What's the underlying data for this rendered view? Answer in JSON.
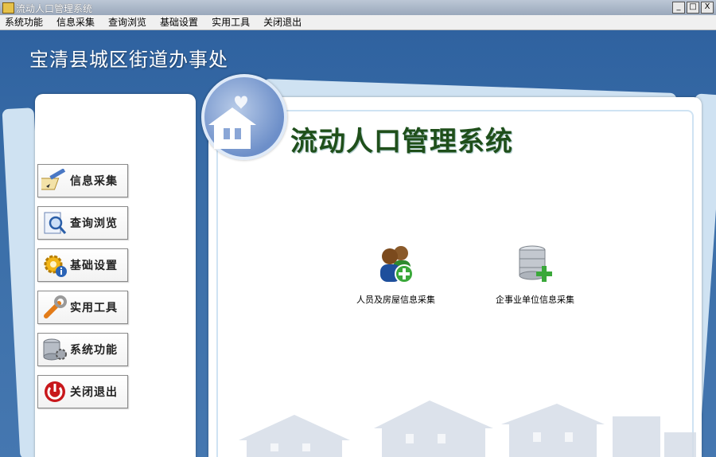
{
  "window": {
    "title": "流动人口管理系统",
    "buttons": [
      "_",
      "□",
      "X"
    ]
  },
  "menu": [
    "系统功能",
    "信息采集",
    "查询浏览",
    "基础设置",
    "实用工具",
    "关闭退出"
  ],
  "org_name": "宝清县城区街道办事处",
  "system_title": "流动人口管理系统",
  "sidebar": [
    {
      "label": "信息采集",
      "icon": "pencil-paper-icon"
    },
    {
      "label": "查询浏览",
      "icon": "magnifier-document-icon"
    },
    {
      "label": "基础设置",
      "icon": "gear-info-icon"
    },
    {
      "label": "实用工具",
      "icon": "wrench-icon"
    },
    {
      "label": "系统功能",
      "icon": "database-gear-icon"
    },
    {
      "label": "关闭退出",
      "icon": "power-icon"
    }
  ],
  "quick_actions": [
    {
      "label": "人员及房屋信息采集",
      "icon": "users-add-icon"
    },
    {
      "label": "企事业单位信息采集",
      "icon": "database-add-icon"
    }
  ]
}
